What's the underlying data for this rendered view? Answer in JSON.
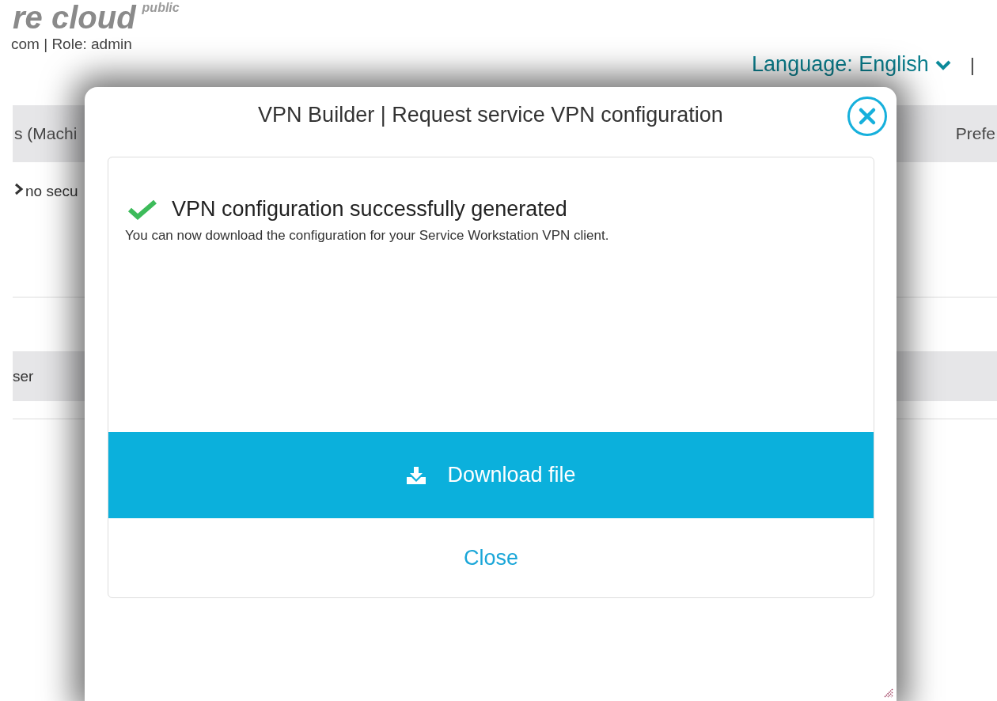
{
  "header": {
    "logo": "re cloud",
    "logo_tag": "public",
    "user_line": "com | Role: admin",
    "language": "Language: English",
    "separator": "|"
  },
  "tabs": [
    {
      "label": "s (Machi",
      "selected": false
    },
    {
      "label": "Prefe",
      "selected": false
    }
  ],
  "rows": [
    {
      "kind": "link",
      "text": "no secu"
    },
    {
      "kind": "plain",
      "text": "ser"
    }
  ],
  "dialog": {
    "title": "VPN Builder | Request service VPN configuration",
    "heading": "VPN configuration successfully generated",
    "message": "You can now download the configuration for your Service Workstation VPN client.",
    "download_label": "Download file",
    "close_label": "Close"
  }
}
